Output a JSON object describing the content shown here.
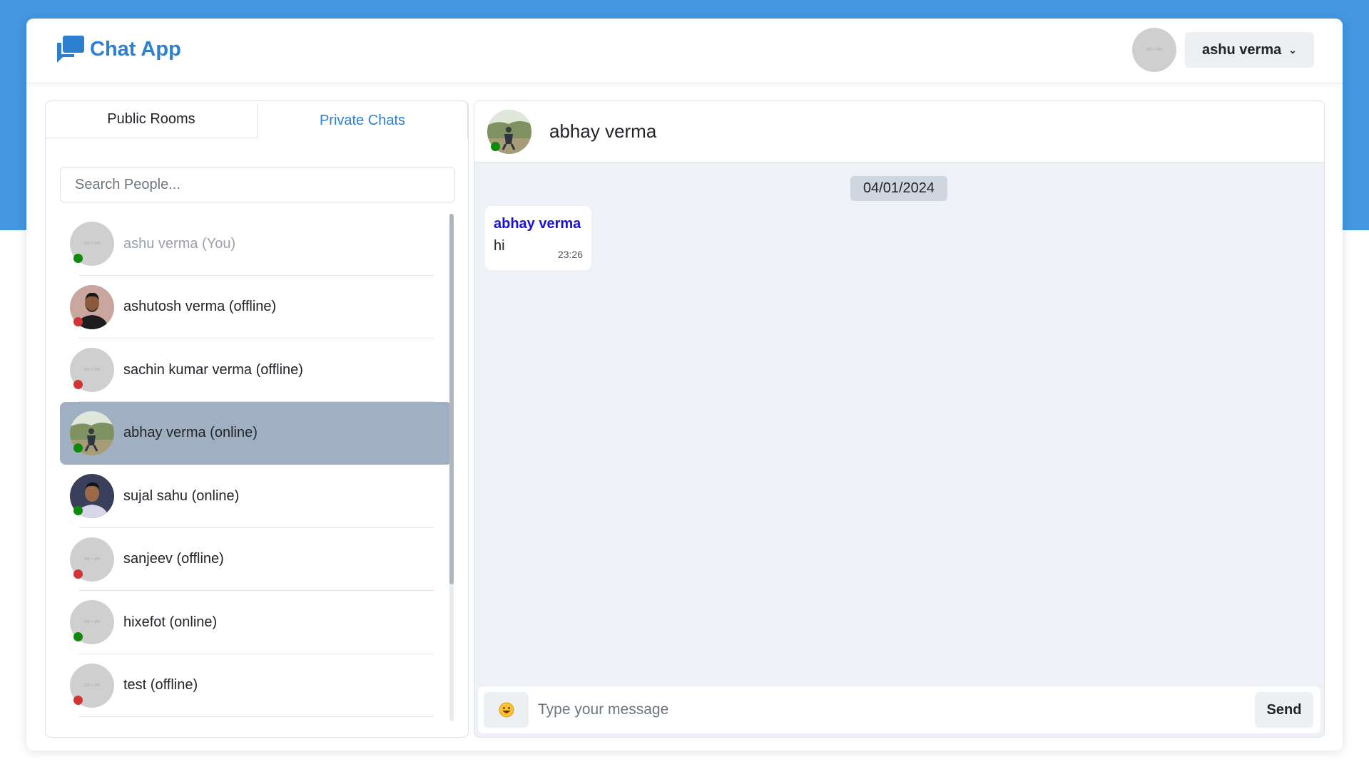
{
  "colors": {
    "brand": "#2d7fd0",
    "band": "#4297e0",
    "selected_row": "#a1afc2",
    "online": "#0b8a0b",
    "offline": "#d23434",
    "sender": "#1a10d8"
  },
  "header": {
    "brand_icon": "chat-bubbles-icon",
    "app_name": "Chat App",
    "avatar_placeholder": "200 × 200",
    "user_name": "ashu verma"
  },
  "sidebar": {
    "tabs": [
      {
        "label": "Public Rooms",
        "active": false
      },
      {
        "label": "Private Chats",
        "active": true
      }
    ],
    "search_placeholder": "Search People...",
    "people": [
      {
        "name": "ashu verma (You)",
        "status": "online",
        "photo": "placeholder",
        "self": true,
        "selected": false
      },
      {
        "name": "ashutosh verma (offline)",
        "status": "offline",
        "photo": "man-portrait",
        "self": false,
        "selected": false
      },
      {
        "name": "sachin kumar verma (offline)",
        "status": "offline",
        "photo": "placeholder",
        "self": false,
        "selected": false
      },
      {
        "name": "abhay verma (online)",
        "status": "online",
        "photo": "outdoor-photo",
        "self": false,
        "selected": true
      },
      {
        "name": "sujal sahu (online)",
        "status": "online",
        "photo": "young-man-portrait",
        "self": false,
        "selected": false
      },
      {
        "name": "sanjeev (offline)",
        "status": "offline",
        "photo": "placeholder",
        "self": false,
        "selected": false
      },
      {
        "name": "hixefot (online)",
        "status": "online",
        "photo": "placeholder",
        "self": false,
        "selected": false
      },
      {
        "name": "test (offline)",
        "status": "offline",
        "photo": "placeholder",
        "self": false,
        "selected": false
      }
    ]
  },
  "chat": {
    "contact_name": "abhay verma",
    "contact_status": "online",
    "date_label": "04/01/2024",
    "messages": [
      {
        "sender": "abhay verma",
        "text": "hi",
        "time": "23:26"
      }
    ],
    "composer": {
      "emoji_icon": "grinning-face-icon",
      "placeholder": "Type your message",
      "send_label": "Send"
    }
  }
}
